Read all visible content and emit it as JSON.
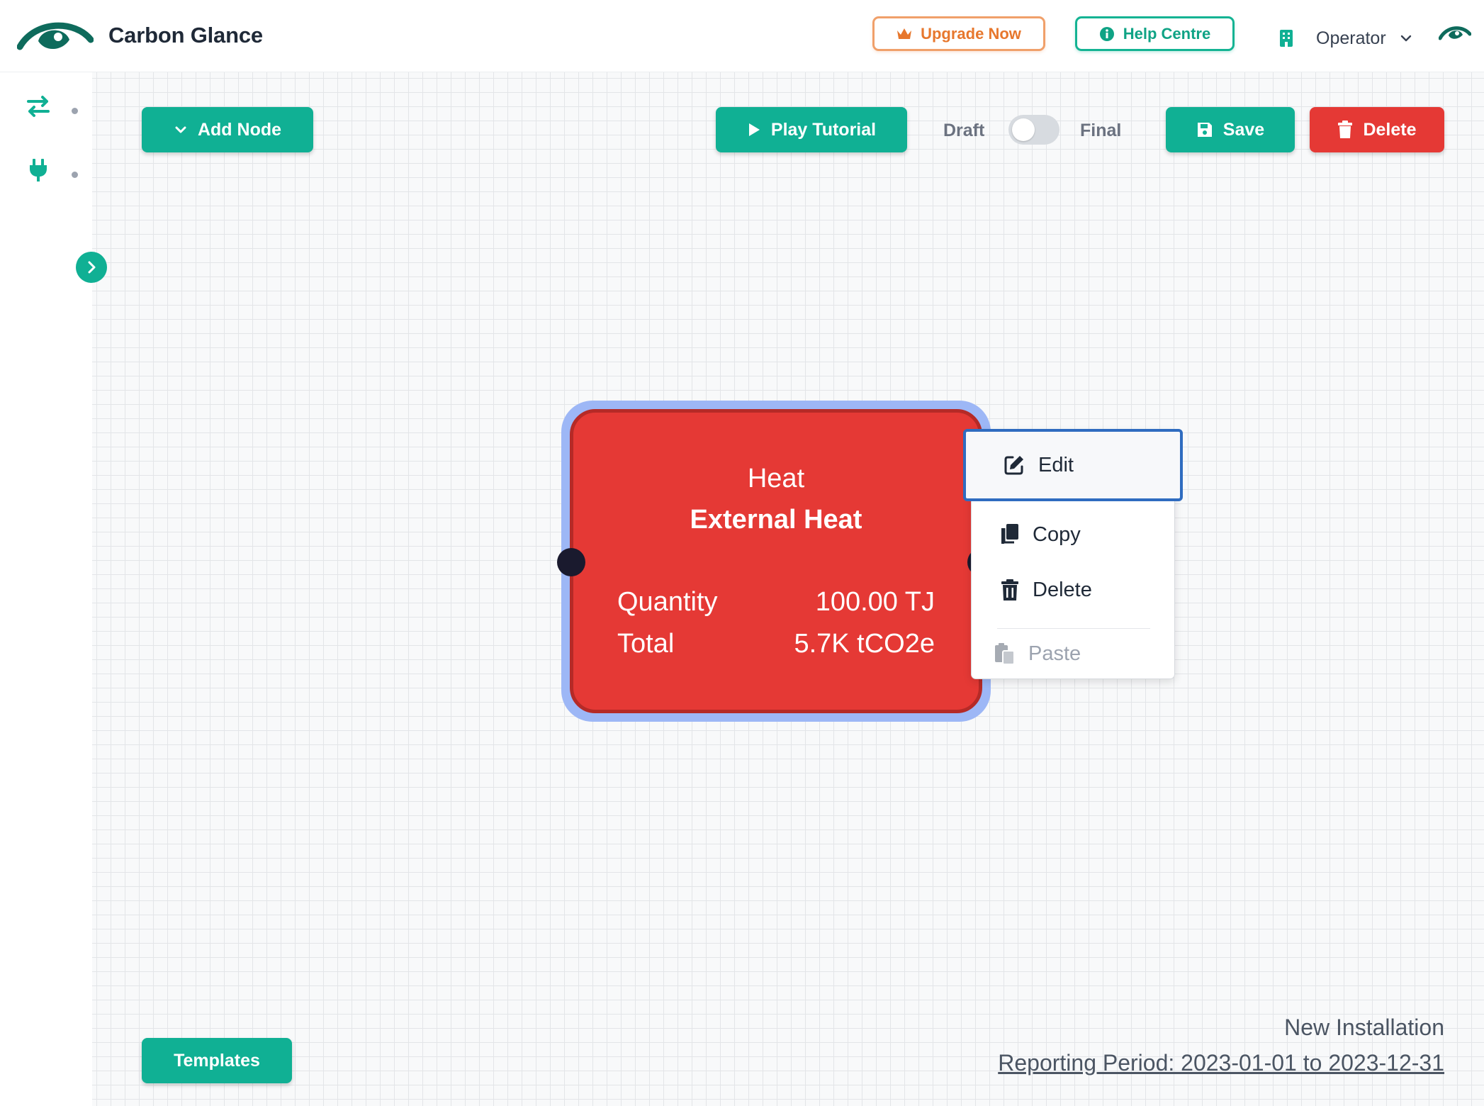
{
  "header": {
    "brand": "Carbon Glance",
    "upgrade_label": "Upgrade Now",
    "help_label": "Help Centre",
    "user_role": "Operator"
  },
  "toolbar": {
    "add_node_label": "Add Node",
    "play_tutorial_label": "Play Tutorial",
    "toggle_left_label": "Draft",
    "toggle_right_label": "Final",
    "toggle_state": "Draft",
    "save_label": "Save",
    "delete_label": "Delete"
  },
  "node": {
    "type": "Heat",
    "name": "External Heat",
    "rows": [
      {
        "label": "Quantity",
        "value": "100.00 TJ"
      },
      {
        "label": "Total",
        "value": "5.7K tCO2e"
      }
    ],
    "color": "#e53935"
  },
  "context_menu": {
    "items": [
      {
        "label": "Edit",
        "icon": "edit-icon",
        "enabled": true
      },
      {
        "label": "Copy",
        "icon": "copy-icon",
        "enabled": true
      },
      {
        "label": "Delete",
        "icon": "trash-icon",
        "enabled": true
      },
      {
        "label": "Paste",
        "icon": "paste-icon",
        "enabled": false
      }
    ]
  },
  "footer": {
    "installation": "New Installation",
    "reporting_period": "Reporting Period: 2023-01-01 to 2023-12-31",
    "templates_label": "Templates"
  },
  "colors": {
    "primary": "#10b094",
    "danger": "#e53935",
    "upgrade": "#e7772d",
    "focus": "#2f6cc0",
    "node_selection": "#9db7f6"
  }
}
